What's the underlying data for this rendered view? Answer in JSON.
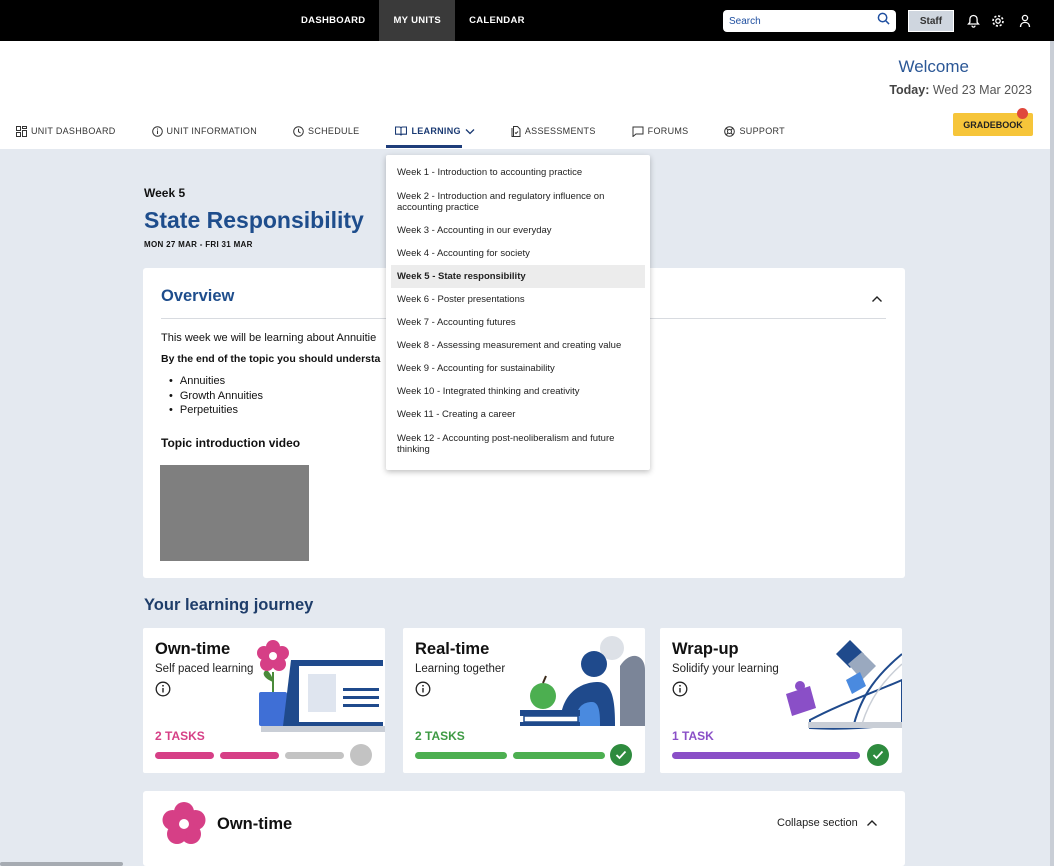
{
  "topnav": {
    "items": [
      {
        "label": "DASHBOARD",
        "active": false
      },
      {
        "label": "MY UNITS",
        "active": true
      },
      {
        "label": "CALENDAR",
        "active": false
      }
    ],
    "search_placeholder": "Search",
    "staff_label": "Staff",
    "icons": [
      "search-icon",
      "bell-icon",
      "gear-icon",
      "user-icon"
    ]
  },
  "header": {
    "welcome": "Welcome",
    "today_label": "Today:",
    "today_value": "Wed 23 Mar 2023",
    "gradebook_label": "GRADEBOOK"
  },
  "unitnav": {
    "items": [
      {
        "label": "UNIT DASHBOARD",
        "icon": "grid-icon"
      },
      {
        "label": "UNIT INFORMATION",
        "icon": "info-icon"
      },
      {
        "label": "SCHEDULE",
        "icon": "clock-icon"
      },
      {
        "label": "LEARNING",
        "icon": "book-icon",
        "active": true
      },
      {
        "label": "ASSESSMENTS",
        "icon": "document-icon"
      },
      {
        "label": "FORUMS",
        "icon": "chat-icon"
      },
      {
        "label": "SUPPORT",
        "icon": "lifebuoy-icon"
      }
    ]
  },
  "dropdown": {
    "items": [
      "Week 1 - Introduction to accounting practice",
      "Week 2 - Introduction and regulatory influence on accounting practice",
      "Week 3 - Accounting in our everyday",
      "Week 4 - Accounting for society",
      "Week 5 - State responsibility",
      "Week 6 - Poster presentations",
      "Week 7 - Accounting futures",
      "Week 8 - Assessing measurement and creating value",
      "Week 9 - Accounting for sustainability",
      "Week 10 - Integrated thinking and creativity",
      "Week 11 - Creating a career",
      "Week 12 - Accounting post-neoliberalism and future thinking"
    ],
    "active_index": 4
  },
  "week": {
    "label": "Week 5",
    "title": "State Responsibility",
    "dates": "MON 27 MAR - FRI 31 MAR"
  },
  "overview": {
    "title": "Overview",
    "intro": "This week we will be learning about Annuitie",
    "objectives_heading": "By the end of the topic you should understa",
    "topics": [
      "Annuities",
      "Growth Annuities",
      "Perpetuities"
    ],
    "video_label": "Topic introduction video"
  },
  "journey": {
    "title": "Your learning journey",
    "cards": [
      {
        "title": "Own-time",
        "subtitle": "Self paced learning",
        "tasks": "2 TASKS",
        "color": "#d63f86",
        "complete": false
      },
      {
        "title": "Real-time",
        "subtitle": "Learning together",
        "tasks": "2 TASKS",
        "color": "#4caf50",
        "complete": true
      },
      {
        "title": "Wrap-up",
        "subtitle": "Solidify your learning",
        "tasks": "1 TASK",
        "color": "#8a4fc7",
        "complete": true
      }
    ]
  },
  "section": {
    "title": "Own-time",
    "collapse_label": "Collapse section"
  },
  "colors": {
    "brand_blue": "#1e4d8c",
    "gradebook": "#f6c53a",
    "notification_dot": "#e0483c"
  }
}
